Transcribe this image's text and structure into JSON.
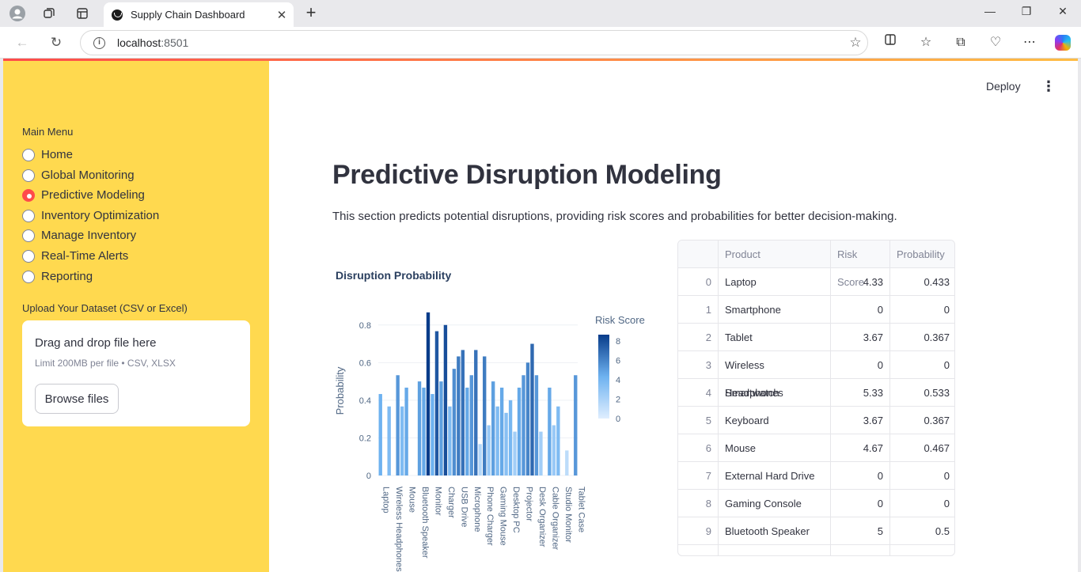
{
  "browser": {
    "tab_title": "Supply Chain Dashboard",
    "url_host": "localhost",
    "url_port": ":8501"
  },
  "sidebar": {
    "menu_label": "Main Menu",
    "items": [
      {
        "label": "Home",
        "selected": false
      },
      {
        "label": "Global Monitoring",
        "selected": false
      },
      {
        "label": "Predictive Modeling",
        "selected": true
      },
      {
        "label": "Inventory Optimization",
        "selected": false
      },
      {
        "label": "Manage Inventory",
        "selected": false
      },
      {
        "label": "Real-Time Alerts",
        "selected": false
      },
      {
        "label": "Reporting",
        "selected": false
      }
    ],
    "upload_label": "Upload Your Dataset (CSV or Excel)",
    "dropzone_title": "Drag and drop file here",
    "dropzone_sub": "Limit 200MB per file • CSV, XLSX",
    "browse_label": "Browse files"
  },
  "header": {
    "deploy_label": "Deploy"
  },
  "main": {
    "title": "Predictive Disruption Modeling",
    "description": "This section predicts potential disruptions, providing risk scores and probabilities for better decision-making."
  },
  "table": {
    "columns": [
      "",
      "Product",
      "Risk Score",
      "Probability"
    ],
    "rows": [
      [
        "0",
        "Laptop",
        "4.33",
        "0.433"
      ],
      [
        "1",
        "Smartphone",
        "0",
        "0"
      ],
      [
        "2",
        "Tablet",
        "3.67",
        "0.367"
      ],
      [
        "3",
        "Wireless Headphones",
        "0",
        "0"
      ],
      [
        "4",
        "Smartwatch",
        "5.33",
        "0.533"
      ],
      [
        "5",
        "Keyboard",
        "3.67",
        "0.367"
      ],
      [
        "6",
        "Mouse",
        "4.67",
        "0.467"
      ],
      [
        "7",
        "External Hard Drive",
        "0",
        "0"
      ],
      [
        "8",
        "Gaming Console",
        "0",
        "0"
      ],
      [
        "9",
        "Bluetooth Speaker",
        "5",
        "0.5"
      ]
    ]
  },
  "chart_data": {
    "type": "bar",
    "title": "Disruption Probability",
    "ylabel": "Probability",
    "xlabel": "",
    "ylim": [
      0,
      0.9
    ],
    "yticks": [
      0,
      0.2,
      0.4,
      0.6,
      0.8
    ],
    "colorbar_title": "Risk Score",
    "colorbar_ticks": [
      0,
      2,
      4,
      6,
      8
    ],
    "x_tick_labels": [
      "Laptop",
      "Wireless Headphones",
      "Mouse",
      "Bluetooth Speaker",
      "Monitor",
      "Charger",
      "USB Drive",
      "Microphone",
      "Phone Charger",
      "Gaming Mouse",
      "Desktop PC",
      "Projector",
      "Desk Organizer",
      "Cable Organizer",
      "Studio Monitor",
      "Tablet Case"
    ],
    "probabilities": [
      0.433,
      0,
      0.367,
      0,
      0.533,
      0.367,
      0.467,
      0,
      0,
      0.5,
      0.467,
      0.867,
      0.433,
      0.767,
      0.5,
      0.8,
      0.367,
      0.567,
      0.633,
      0.667,
      0.467,
      0.533,
      0.667,
      0.167,
      0.633,
      0.267,
      0.5,
      0.367,
      0.467,
      0.333,
      0.4,
      0.233,
      0.467,
      0.533,
      0.6,
      0.7,
      0.533,
      0.233,
      0,
      0.467,
      0.267,
      0.367,
      0,
      0.133,
      0,
      0.533
    ],
    "risk_scores": [
      4.33,
      0,
      3.67,
      0,
      5.33,
      3.67,
      4.67,
      0,
      0,
      5,
      4.67,
      8.67,
      4.33,
      7.67,
      5,
      8,
      3.67,
      5.67,
      6.33,
      6.67,
      4.67,
      5.33,
      6.67,
      1.67,
      6.33,
      2.67,
      5,
      3.67,
      4.67,
      3.33,
      4,
      2.33,
      4.67,
      5.33,
      6,
      7,
      5.33,
      2.33,
      0,
      4.67,
      2.67,
      3.67,
      0,
      1.33,
      0,
      5.33
    ]
  }
}
